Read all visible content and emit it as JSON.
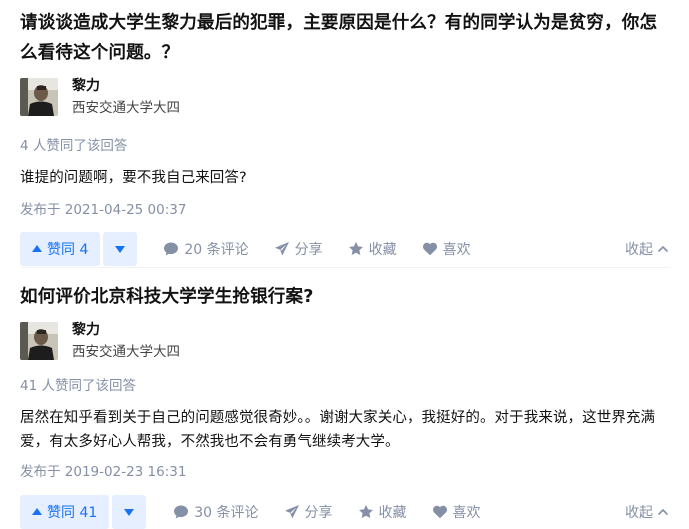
{
  "answers": [
    {
      "question_title": "请谈谈造成大学生黎力最后的犯罪，主要原因是什么？有的同学认为是贫穷，你怎么看待这个问题。？",
      "author": {
        "name": "黎力",
        "headline": "西安交通大学大四"
      },
      "vote_summary": "4 人赞同了该回答",
      "content": "谁提的问题啊，要不我自己来回答?",
      "publish_time": "发布于 2021-04-25 00:37",
      "actions": {
        "upvote_label": "赞同 4",
        "comment_label": "20 条评论",
        "share_label": "分享",
        "collect_label": "收藏",
        "like_label": "喜欢",
        "collapse_label": "收起"
      }
    },
    {
      "question_title": "如何评价北京科技大学学生抢银行案?",
      "author": {
        "name": "黎力",
        "headline": "西安交通大学大四"
      },
      "vote_summary": "41 人赞同了该回答",
      "content": "居然在知乎看到关于自己的问题感觉很奇妙。。谢谢大家关心，我挺好的。对于我来说，这世界充满爱，有太多好心人帮我，不然我也不会有勇气继续考大学。",
      "publish_time": "发布于 2019-02-23 16:31",
      "actions": {
        "upvote_label": "赞同 41",
        "comment_label": "30 条评论",
        "share_label": "分享",
        "collect_label": "收藏",
        "like_label": "喜欢",
        "collapse_label": "收起"
      }
    }
  ],
  "colors": {
    "accent": "#1772f6",
    "accent_bg": "#e5efff",
    "muted": "#8590a6",
    "text": "#121212"
  },
  "icons": {
    "upvote": "triangle-up-icon",
    "downvote": "triangle-down-icon",
    "comment": "comment-bubble-icon",
    "share": "paper-plane-icon",
    "collect": "star-icon",
    "like": "heart-icon",
    "collapse": "chevron-up-icon"
  }
}
